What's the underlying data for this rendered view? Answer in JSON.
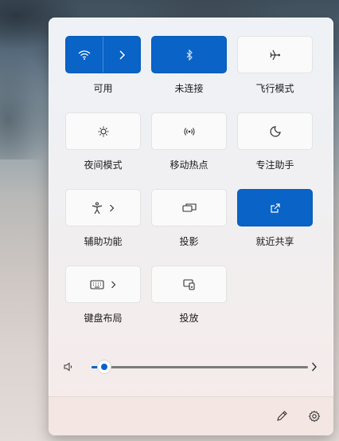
{
  "quick_settings": {
    "tiles": [
      {
        "label": "可用",
        "icon": "wifi-icon",
        "on": true
      },
      {
        "label": "未连接",
        "icon": "bluetooth-icon",
        "on": true
      },
      {
        "label": "飞行模式",
        "icon": "airplane-icon",
        "on": false
      },
      {
        "label": "夜间模式",
        "icon": "night-light-icon",
        "on": false
      },
      {
        "label": "移动热点",
        "icon": "hotspot-icon",
        "on": false
      },
      {
        "label": "专注助手",
        "icon": "moon-icon",
        "on": false
      },
      {
        "label": "辅助功能",
        "icon": "accessibility-icon",
        "on": false
      },
      {
        "label": "投影",
        "icon": "project-icon",
        "on": false
      },
      {
        "label": "就近共享",
        "icon": "nearby-share-icon",
        "on": true
      },
      {
        "label": "键盘布局",
        "icon": "keyboard-icon",
        "on": false
      },
      {
        "label": "投放",
        "icon": "cast-icon",
        "on": false
      }
    ],
    "volume": {
      "level": 0.06,
      "icon": "speaker-icon"
    },
    "footer": {
      "edit_icon": "pencil-icon",
      "settings_icon": "gear-icon"
    },
    "colors": {
      "accent": "#0a63c6",
      "tile": "#fafafa"
    }
  }
}
